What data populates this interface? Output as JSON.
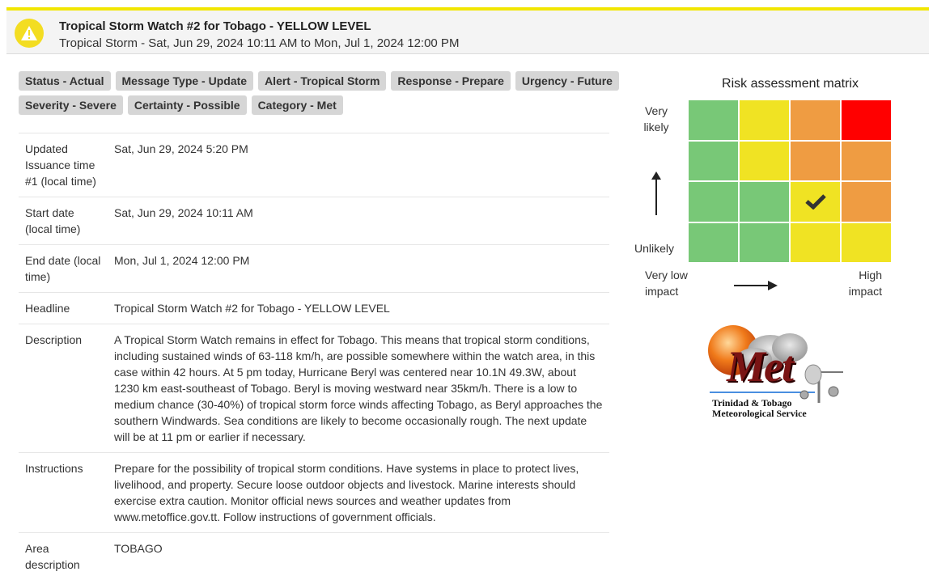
{
  "header": {
    "title": "Tropical Storm Watch #2 for Tobago - YELLOW LEVEL",
    "subtitle": "Tropical Storm - Sat, Jun 29, 2024 10:11 AM to Mon, Jul 1, 2024 12:00 PM",
    "accent_color": "#f2e600",
    "icon": "warning-icon"
  },
  "tags_row1": [
    "Status - Actual",
    "Message Type - Update",
    "Alert - Tropical Storm",
    "Response - Prepare",
    "Urgency - Future"
  ],
  "tags_row2": [
    "Severity - Severe",
    "Certainty - Possible",
    "Category - Met"
  ],
  "details": [
    {
      "label": "Updated Issuance time #1 (local time)",
      "value": "Sat, Jun 29, 2024 5:20 PM"
    },
    {
      "label": "Start date (local time)",
      "value": "Sat, Jun 29, 2024 10:11 AM"
    },
    {
      "label": "End date (local time)",
      "value": "Mon, Jul 1, 2024 12:00 PM"
    },
    {
      "label": "Headline",
      "value": "Tropical Storm Watch #2 for Tobago - YELLOW LEVEL"
    },
    {
      "label": "Description",
      "value": "A Tropical Storm Watch remains in effect for Tobago. This means that tropical storm conditions, including sustained winds of 63-118 km/h, are possible somewhere within the watch area, in this case within 42 hours. At 5 pm today, Hurricane Beryl was centered near 10.1N 49.3W, about 1230 km east-southeast of Tobago. Beryl is moving westward near 35km/h. There is a low to medium chance (30-40%) of tropical storm force winds affecting Tobago, as Beryl approaches the southern Windwards. Sea conditions are likely to become occasionally rough. The next update will be at 11 pm or earlier if necessary."
    },
    {
      "label": "Instructions",
      "value": "Prepare for the possibility of tropical storm conditions. Have systems in place to protect lives, livelihood, and property. Secure loose outdoor objects and livestock. Marine interests should exercise extra caution. Monitor official news sources and weather updates from www.metoffice.gov.tt. Follow instructions of government officials."
    },
    {
      "label": "Area description",
      "value": "TOBAGO"
    }
  ],
  "matrix": {
    "title": "Risk assessment matrix",
    "likelihood_high": "Very likely",
    "likelihood_low": "Unlikely",
    "impact_low": "Very low impact",
    "impact_high": "High impact",
    "colors": {
      "green": "#78c877",
      "yellow": "#f0e323",
      "orange": "#ef9c42",
      "red": "#ff0000"
    },
    "rows": [
      [
        "green",
        "yellow",
        "orange",
        "red"
      ],
      [
        "green",
        "yellow",
        "orange",
        "orange"
      ],
      [
        "green",
        "green",
        "yellow",
        "orange"
      ],
      [
        "green",
        "green",
        "yellow",
        "yellow"
      ]
    ],
    "selected": {
      "row": 3,
      "col": 3
    }
  },
  "logo": {
    "word": "Met",
    "line1": "Trinidad & Tobago",
    "line2": "Meteorological Service"
  }
}
